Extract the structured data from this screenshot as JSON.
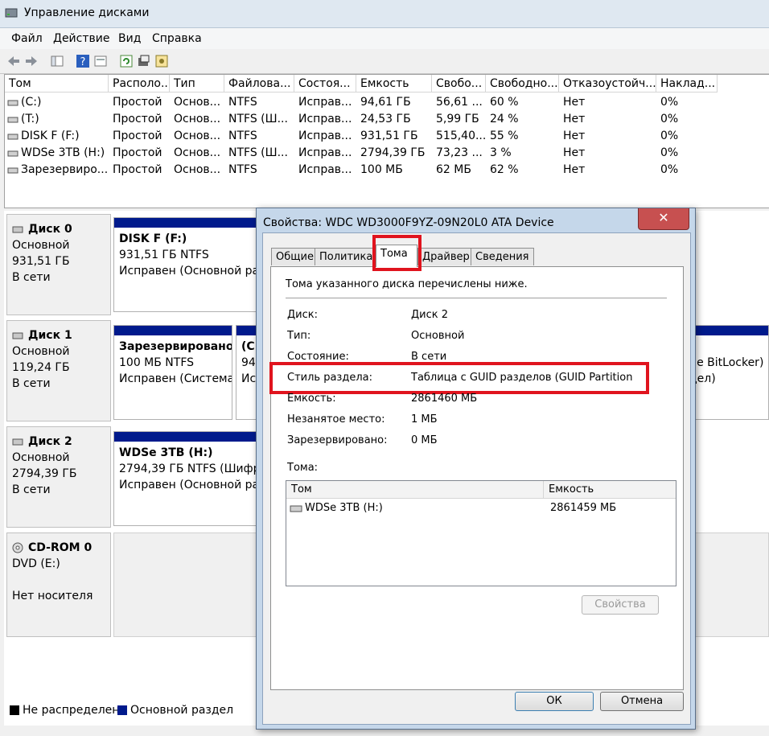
{
  "window": {
    "title": "Управление дисками"
  },
  "menu": [
    "Файл",
    "Действие",
    "Вид",
    "Справка"
  ],
  "volume_list": {
    "columns": [
      "Том",
      "Располо...",
      "Тип",
      "Файлова...",
      "Состоя...",
      "Емкость",
      "Свобо...",
      "Свободно...",
      "Отказоустойч...",
      "Наклад..."
    ],
    "rows": [
      [
        "(C:)",
        "Простой",
        "Основ...",
        "NTFS",
        "Исправ...",
        "94,61 ГБ",
        "56,61 ...",
        "60 %",
        "Нет",
        "0%"
      ],
      [
        "(T:)",
        "Простой",
        "Основ...",
        "NTFS (Ш...",
        "Исправ...",
        "24,53 ГБ",
        "5,99 ГБ",
        "24 %",
        "Нет",
        "0%"
      ],
      [
        "DISK F (F:)",
        "Простой",
        "Основ...",
        "NTFS",
        "Исправ...",
        "931,51 ГБ",
        "515,40...",
        "55 %",
        "Нет",
        "0%"
      ],
      [
        "WDSe 3TB (H:)",
        "Простой",
        "Основ...",
        "NTFS (Ш...",
        "Исправ...",
        "2794,39 ГБ",
        "73,23 ...",
        "3 %",
        "Нет",
        "0%"
      ],
      [
        "Зарезервиро...",
        "Простой",
        "Основ...",
        "NTFS",
        "Исправ...",
        "100 МБ",
        "62 МБ",
        "62 %",
        "Нет",
        "0%"
      ]
    ]
  },
  "disks": [
    {
      "name": "Диск 0",
      "type": "Основной",
      "size": "931,51 ГБ",
      "status": "В сети",
      "partitions": [
        {
          "title": "DISK F  (F:)",
          "line1": "931,51 ГБ NTFS",
          "line2": "Исправен (Основной раз"
        }
      ]
    },
    {
      "name": "Диск 1",
      "type": "Основной",
      "size": "119,24 ГБ",
      "status": "В сети",
      "partitions": [
        {
          "title": "Зарезервировано с",
          "line1": "100 МБ NTFS",
          "line2": "Исправен (Система"
        },
        {
          "title": "(С",
          "line1": "94,",
          "line2": "Ис"
        },
        {
          "title": "",
          "line1": "ие BitLocker)",
          "line2": "дел)"
        }
      ]
    },
    {
      "name": "Диск 2",
      "type": "Основной",
      "size": "2794,39 ГБ",
      "status": "В сети",
      "partitions": [
        {
          "title": "WDSe 3TB  (H:)",
          "line1": "2794,39 ГБ NTFS (Шифро",
          "line2": "Исправен (Основной раз"
        }
      ]
    },
    {
      "name": "CD-ROM 0",
      "type": "DVD (E:)",
      "size": "",
      "status": "Нет носителя",
      "partitions": []
    }
  ],
  "legend": {
    "unallocated": "Не распределен",
    "primary": "Основной раздел",
    "unallocated_color": "#000000",
    "primary_color": "#001a8c"
  },
  "dialog": {
    "title": "Свойства: WDC WD3000F9YZ-09N20L0 ATA Device",
    "close_icon": "close-icon",
    "tabs": [
      "Общие",
      "Политика",
      "Тома",
      "Драйвер",
      "Сведения"
    ],
    "active_tab": "Тома",
    "description": "Тома указанного диска перечислены ниже.",
    "props": [
      {
        "label": "Диск:",
        "value": "Диск 2"
      },
      {
        "label": "Тип:",
        "value": "Основной"
      },
      {
        "label": "Состояние:",
        "value": "В сети"
      },
      {
        "label": "Стиль раздела:",
        "value": "Таблица с GUID разделов (GUID Partition"
      },
      {
        "label": "Емкость:",
        "value": "2861460 МБ"
      },
      {
        "label": "Незанятое место:",
        "value": "1 МБ"
      },
      {
        "label": "Зарезервировано:",
        "value": "0 МБ"
      }
    ],
    "volumes_label": "Тома:",
    "volumes_columns": [
      "Том",
      "Емкость"
    ],
    "volumes_rows": [
      {
        "name": "WDSe 3TB (H:)",
        "size": "2861459 МБ"
      }
    ],
    "properties_button": "Свойства",
    "ok_button": "ОК",
    "cancel_button": "Отмена",
    "highlight_color": "#e0141e"
  }
}
